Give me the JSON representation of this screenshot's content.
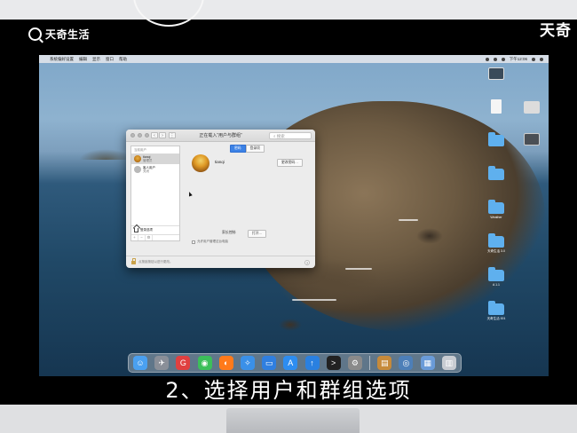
{
  "branding": {
    "logo_text": "天奇生活",
    "corner_mark": "天奇"
  },
  "menubar": {
    "items": [
      "系统偏好设置",
      "编辑",
      "显示",
      "窗口",
      "帮助"
    ],
    "clock": "下午12:06"
  },
  "desktop_icons": [
    {
      "label": ""
    },
    {
      "label": ""
    },
    {
      "label": ""
    },
    {
      "label": ""
    },
    {
      "label": ""
    },
    {
      "label": ""
    },
    {
      "label": "Weather"
    },
    {
      "label": "天奇生活 3.0"
    },
    {
      "label": "A 1.1"
    },
    {
      "label": "天奇生活 001"
    }
  ],
  "window": {
    "title": "正在载入“用户与群组”",
    "search_placeholder": "搜索",
    "sidebar": {
      "header": "当前用户",
      "current_user": {
        "name": "tianqi",
        "role": "管理员"
      },
      "guest": {
        "name": "客人用户",
        "sub": "关闭"
      },
      "login_options": "登录选项",
      "toolbar": [
        "+",
        "−",
        "⚙"
      ]
    },
    "tabs": [
      "密码",
      "登录项"
    ],
    "user_name": "tianqi",
    "change_password": "更改密码…",
    "parental_label": "家长控制:",
    "open_button": "打开…",
    "allow_admin": "允许用户管理这台电脑",
    "lock_text": "点按锁按钮以进行更改。",
    "help": "?"
  },
  "dock": {
    "apps": [
      {
        "icon": "finder-icon",
        "color": "#4aa0f0"
      },
      {
        "icon": "launchpad-icon",
        "color": "#8a8f98"
      },
      {
        "icon": "weibo-icon",
        "color": "#e04040"
      },
      {
        "icon": "wechat-icon",
        "color": "#3cbf5a"
      },
      {
        "icon": "firefox-icon",
        "color": "#ff7a1a"
      },
      {
        "icon": "safari-icon",
        "color": "#3a90e8"
      },
      {
        "icon": "files-icon",
        "color": "#2f7fe0"
      },
      {
        "icon": "appstore-icon",
        "color": "#2d8df0"
      },
      {
        "icon": "update-icon",
        "color": "#2a80e0"
      },
      {
        "icon": "terminal-icon",
        "color": "#222222"
      },
      {
        "icon": "system-preferences-icon",
        "color": "#8a8a8a"
      },
      {
        "icon": "archive-icon",
        "color": "#c68a3a"
      },
      {
        "icon": "screenshot-icon",
        "color": "#4d7fb8"
      },
      {
        "icon": "preview-icon",
        "color": "#6a9bd8"
      },
      {
        "icon": "trash-icon",
        "color": "#c8ccd2"
      }
    ]
  },
  "caption": "2、选择用户和群组选项"
}
